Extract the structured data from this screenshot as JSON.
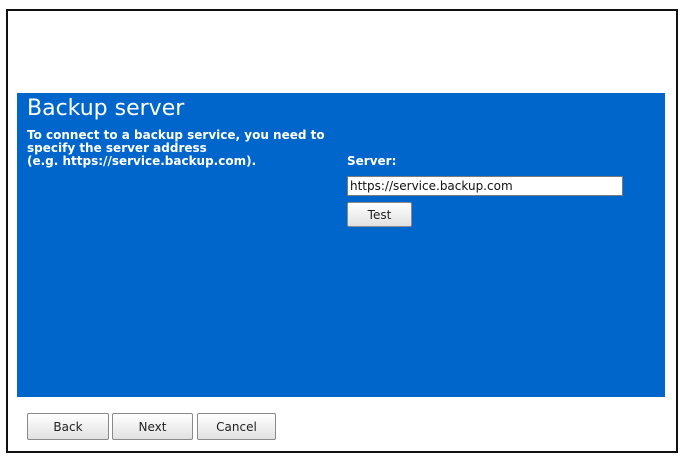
{
  "panel": {
    "title": "Backup server",
    "description": [
      "To connect to a backup service, you need to",
      "specify the server address",
      "(e.g. https://service.backup.com)."
    ],
    "server_label": "Server:",
    "server_value": "https://service.backup.com",
    "test_label": "Test",
    "background_color": "#0066cc"
  },
  "footer": {
    "back_label": "Back",
    "next_label": "Next",
    "cancel_label": "Cancel"
  }
}
